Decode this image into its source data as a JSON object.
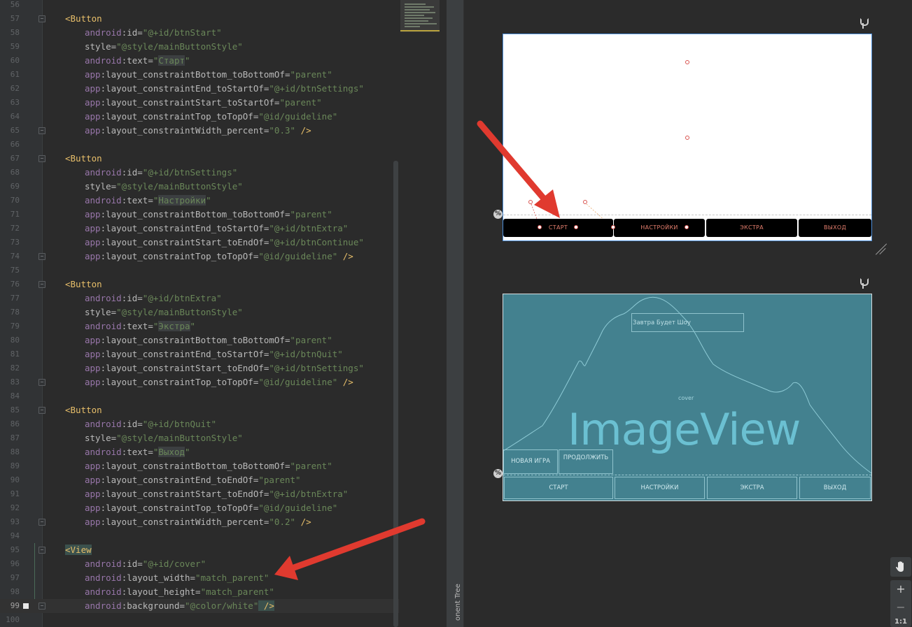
{
  "editor": {
    "lines": [
      {
        "num": "56",
        "kind": "blank"
      },
      {
        "num": "57",
        "kind": "open",
        "tag": "<Button",
        "fold": true
      },
      {
        "num": "58",
        "kind": "attr",
        "ns": "android",
        "attr": ":id=",
        "val": "\"@+id/btnStart\""
      },
      {
        "num": "59",
        "kind": "attr",
        "ns": "",
        "attr": "style=",
        "val": "\"@style/mainButtonStyle\""
      },
      {
        "num": "60",
        "kind": "attrtext",
        "ns": "android",
        "attr": ":text=",
        "q1": "\"",
        "text": "Старт",
        "q2": "\""
      },
      {
        "num": "61",
        "kind": "attr",
        "ns": "app",
        "attr": ":layout_constraintBottom_toBottomOf=",
        "val": "\"parent\""
      },
      {
        "num": "62",
        "kind": "attr",
        "ns": "app",
        "attr": ":layout_constraintEnd_toStartOf=",
        "val": "\"@+id/btnSettings\""
      },
      {
        "num": "63",
        "kind": "attr",
        "ns": "app",
        "attr": ":layout_constraintStart_toStartOf=",
        "val": "\"parent\""
      },
      {
        "num": "64",
        "kind": "attr",
        "ns": "app",
        "attr": ":layout_constraintTop_toTopOf=",
        "val": "\"@id/guideline\""
      },
      {
        "num": "65",
        "kind": "attrclose",
        "ns": "app",
        "attr": ":layout_constraintWidth_percent=",
        "val": "\"0.3\"",
        "close": " />",
        "fold": true
      },
      {
        "num": "66",
        "kind": "blank"
      },
      {
        "num": "67",
        "kind": "open",
        "tag": "<Button",
        "fold": true
      },
      {
        "num": "68",
        "kind": "attr",
        "ns": "android",
        "attr": ":id=",
        "val": "\"@+id/btnSettings\""
      },
      {
        "num": "69",
        "kind": "attr",
        "ns": "",
        "attr": "style=",
        "val": "\"@style/mainButtonStyle\""
      },
      {
        "num": "70",
        "kind": "attrtext",
        "ns": "android",
        "attr": ":text=",
        "q1": "\"",
        "text": "Настройки",
        "q2": "\""
      },
      {
        "num": "71",
        "kind": "attr",
        "ns": "app",
        "attr": ":layout_constraintBottom_toBottomOf=",
        "val": "\"parent\""
      },
      {
        "num": "72",
        "kind": "attr",
        "ns": "app",
        "attr": ":layout_constraintEnd_toStartOf=",
        "val": "\"@+id/btnExtra\""
      },
      {
        "num": "73",
        "kind": "attr",
        "ns": "app",
        "attr": ":layout_constraintStart_toEndOf=",
        "val": "\"@+id/btnContinue\""
      },
      {
        "num": "74",
        "kind": "attrclose",
        "ns": "app",
        "attr": ":layout_constraintTop_toTopOf=",
        "val": "\"@id/guideline\"",
        "close": " />",
        "fold": true
      },
      {
        "num": "75",
        "kind": "blank"
      },
      {
        "num": "76",
        "kind": "open",
        "tag": "<Button",
        "fold": true
      },
      {
        "num": "77",
        "kind": "attr",
        "ns": "android",
        "attr": ":id=",
        "val": "\"@+id/btnExtra\""
      },
      {
        "num": "78",
        "kind": "attr",
        "ns": "",
        "attr": "style=",
        "val": "\"@style/mainButtonStyle\""
      },
      {
        "num": "79",
        "kind": "attrtext",
        "ns": "android",
        "attr": ":text=",
        "q1": "\"",
        "text": "Экстра",
        "q2": "\""
      },
      {
        "num": "80",
        "kind": "attr",
        "ns": "app",
        "attr": ":layout_constraintBottom_toBottomOf=",
        "val": "\"parent\""
      },
      {
        "num": "81",
        "kind": "attr",
        "ns": "app",
        "attr": ":layout_constraintEnd_toStartOf=",
        "val": "\"@+id/btnQuit\""
      },
      {
        "num": "82",
        "kind": "attr",
        "ns": "app",
        "attr": ":layout_constraintStart_toEndOf=",
        "val": "\"@+id/btnSettings\""
      },
      {
        "num": "83",
        "kind": "attrclose",
        "ns": "app",
        "attr": ":layout_constraintTop_toTopOf=",
        "val": "\"@id/guideline\"",
        "close": " />",
        "fold": true
      },
      {
        "num": "84",
        "kind": "blank"
      },
      {
        "num": "85",
        "kind": "open",
        "tag": "<Button",
        "fold": true
      },
      {
        "num": "86",
        "kind": "attr",
        "ns": "android",
        "attr": ":id=",
        "val": "\"@+id/btnQuit\""
      },
      {
        "num": "87",
        "kind": "attr",
        "ns": "",
        "attr": "style=",
        "val": "\"@style/mainButtonStyle\""
      },
      {
        "num": "88",
        "kind": "attrtext",
        "ns": "android",
        "attr": ":text=",
        "q1": "\"",
        "text": "Выход",
        "q2": "\""
      },
      {
        "num": "89",
        "kind": "attr",
        "ns": "app",
        "attr": ":layout_constraintBottom_toBottomOf=",
        "val": "\"parent\""
      },
      {
        "num": "90",
        "kind": "attr",
        "ns": "app",
        "attr": ":layout_constraintEnd_toEndOf=",
        "val": "\"parent\""
      },
      {
        "num": "91",
        "kind": "attr",
        "ns": "app",
        "attr": ":layout_constraintStart_toEndOf=",
        "val": "\"@+id/btnExtra\""
      },
      {
        "num": "92",
        "kind": "attr",
        "ns": "app",
        "attr": ":layout_constraintTop_toTopOf=",
        "val": "\"@id/guideline\""
      },
      {
        "num": "93",
        "kind": "attrclose",
        "ns": "app",
        "attr": ":layout_constraintWidth_percent=",
        "val": "\"0.2\"",
        "close": " />",
        "fold": true
      },
      {
        "num": "94",
        "kind": "blank"
      },
      {
        "num": "95",
        "kind": "open",
        "tag": "<View",
        "fold": true,
        "highlight": true
      },
      {
        "num": "96",
        "kind": "attr",
        "ns": "android",
        "attr": ":id=",
        "val": "\"@+id/cover\""
      },
      {
        "num": "97",
        "kind": "attr",
        "ns": "android",
        "attr": ":layout_width=",
        "val": "\"match_parent\""
      },
      {
        "num": "98",
        "kind": "attr",
        "ns": "android",
        "attr": ":layout_height=",
        "val": "\"match_parent\""
      },
      {
        "num": "99",
        "kind": "attrclose",
        "ns": "android",
        "attr": ":background=",
        "val": "\"@color/white\"",
        "close": " />",
        "fold": true,
        "current": true,
        "bookmark": true,
        "closeHighlight": true
      },
      {
        "num": "100",
        "kind": "blank"
      }
    ]
  },
  "side_panel": {
    "label": "onent Tree"
  },
  "blueprint": {
    "buttons": [
      {
        "id": "start",
        "label": "СТАРТ"
      },
      {
        "id": "settings",
        "label": "НАСТРОЙКИ"
      },
      {
        "id": "extra",
        "label": "ЭКСТРА"
      },
      {
        "id": "quit",
        "label": "ВЫХОД"
      }
    ],
    "percent_badge": "%"
  },
  "preview": {
    "title_label": "Завтра Будет Шоу",
    "cover_label": "cover",
    "imageview_label": "ImageView",
    "top_buttons": [
      {
        "id": "new-game",
        "label": "НОВАЯ ИГРА"
      },
      {
        "id": "continue",
        "label": "ПРОДОЛЖИТЬ"
      }
    ],
    "bottom_buttons": [
      {
        "id": "start",
        "label": "СТАРТ"
      },
      {
        "id": "settings",
        "label": "НАСТРОЙКИ"
      },
      {
        "id": "extra",
        "label": "ЭКСТРА"
      },
      {
        "id": "quit",
        "label": "ВЫХОД"
      }
    ],
    "percent_badge": "%"
  },
  "toolbar": {
    "pan_icon": "hand-icon",
    "zoom_in": "+",
    "zoom_out": "−",
    "actual_size": "1:1"
  },
  "colors": {
    "editor_bg": "#2b2b2b",
    "tag": "#e8bf6a",
    "namespace": "#9876aa",
    "value": "#6a8759",
    "blueprint_button_text": "#e57f6e",
    "preview_bg": "#43818f",
    "annotation_arrow": "#e03a2f"
  }
}
